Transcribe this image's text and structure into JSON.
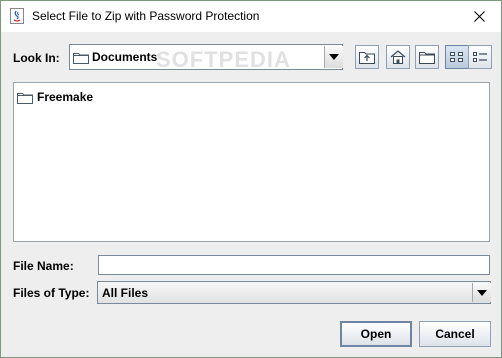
{
  "window": {
    "title": "Select File to Zip with Password Protection"
  },
  "look_in": {
    "label": "Look In:",
    "value": "Documents"
  },
  "toolbar": {
    "icons": [
      "up-one-level-icon",
      "home-icon",
      "new-folder-icon",
      "list-view-icon",
      "details-view-icon"
    ]
  },
  "file_list": {
    "items": [
      {
        "name": "Freemake",
        "type": "folder"
      }
    ]
  },
  "file_name": {
    "label": "File Name:",
    "value": ""
  },
  "files_of_type": {
    "label": "Files of Type:",
    "value": "All Files"
  },
  "buttons": {
    "open": "Open",
    "cancel": "Cancel"
  },
  "watermark": "SOFTPEDIA",
  "colors": {
    "accent": "#6e86a4",
    "window_border": "#7a9a7a"
  }
}
